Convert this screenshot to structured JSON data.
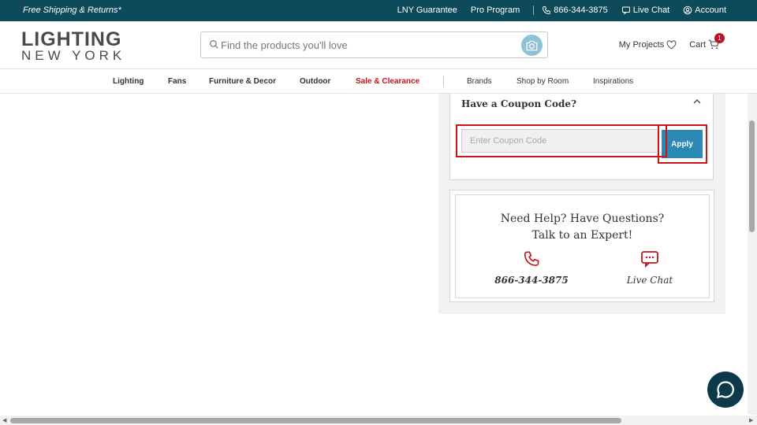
{
  "topbar": {
    "shipping": "Free Shipping & Returns*",
    "guarantee": "LNY Guarantee",
    "pro": "Pro Program",
    "phone": "866-344-3875",
    "chat": "Live Chat",
    "account": "Account"
  },
  "logo": {
    "line1": "LIGHTING",
    "line2": "NEW YORK"
  },
  "search": {
    "placeholder": "Find the products you'll love",
    "value": ""
  },
  "header": {
    "projects": "My Projects",
    "cart": "Cart",
    "cart_count": "1"
  },
  "nav": {
    "items": [
      "Lighting",
      "Fans",
      "Furniture & Decor",
      "Outdoor",
      "Sale & Clearance",
      "Brands",
      "Shop by Room",
      "Inspirations"
    ]
  },
  "coupon": {
    "title": "Have a Coupon Code?",
    "placeholder": "Enter Coupon Code",
    "apply": "Apply"
  },
  "help": {
    "line1": "Need Help? Have Questions?",
    "line2": "Talk to an Expert!",
    "phone": "866-344-3875",
    "chat": "Live Chat"
  },
  "colors": {
    "topbar": "#0d4a5a",
    "accent": "#2b87b3",
    "sale": "#c0141c",
    "highlight": "#d01218"
  },
  "icons": [
    "phone-icon",
    "chat-icon",
    "account-icon",
    "search-icon",
    "camera-icon",
    "heart-icon",
    "cart-icon",
    "chevron-up-icon",
    "chat-bubble-icon"
  ]
}
